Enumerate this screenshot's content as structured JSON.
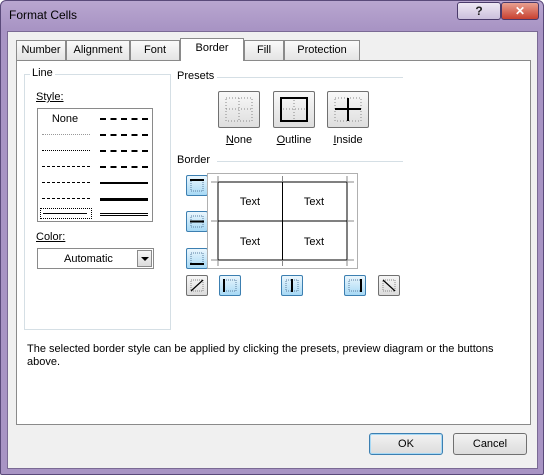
{
  "window": {
    "title": "Format Cells"
  },
  "tabs": [
    {
      "label": "Number"
    },
    {
      "label": "Alignment"
    },
    {
      "label": "Font"
    },
    {
      "label": "Border",
      "active": true
    },
    {
      "label": "Fill"
    },
    {
      "label": "Protection"
    }
  ],
  "line": {
    "group_label": "Line",
    "style_label": "Style:",
    "styles_left": [
      "None",
      "hair-dotted",
      "dotted",
      "dash-dot-dot",
      "dash-dot",
      "dashed",
      "thin-selected"
    ],
    "styles_right": [
      "medium-dash-dot-dot",
      "slanted-dash-dot",
      "medium-dash-dot",
      "medium-dashed",
      "medium",
      "thick",
      "double"
    ],
    "none_text": "None",
    "color_label": "Color:",
    "color_value": "Automatic"
  },
  "presets": {
    "group_label": "Presets",
    "items": [
      {
        "label": "None",
        "underline": "N",
        "rest": "one"
      },
      {
        "label": "Outline",
        "underline": "O",
        "rest": "utline"
      },
      {
        "label": "Inside",
        "underline": "I",
        "rest": "nside"
      }
    ]
  },
  "border": {
    "group_label": "Border",
    "preview_cells": [
      "Text",
      "Text",
      "Text",
      "Text"
    ]
  },
  "description": "The selected border style can be applied by clicking the presets, preview diagram or the buttons above.",
  "buttons": {
    "ok": "OK",
    "cancel": "Cancel"
  },
  "colors": {
    "accent_border": "#3c7fb1",
    "accent_fill": "#a7d9f5",
    "title_bar": "#a894c4"
  }
}
